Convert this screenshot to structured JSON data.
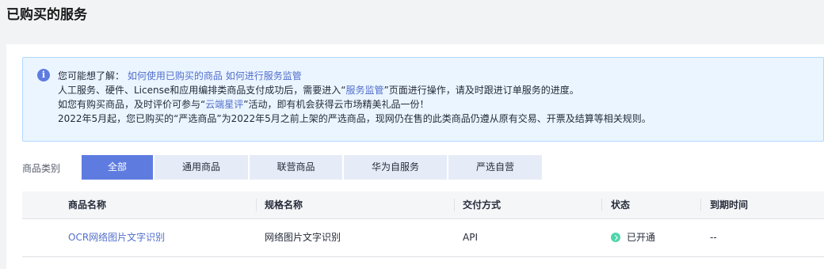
{
  "page": {
    "title": "已购买的服务"
  },
  "notice": {
    "line1": {
      "prefix": "您可能想了解：",
      "link1": "如何使用已购买的商品",
      "link2": "如何进行服务监管"
    },
    "line2": {
      "prefix": "人工服务、硬件、License和应用编排类商品支付成功后，需要进入“",
      "link": "服务监管",
      "suffix": "”页面进行操作，请及时跟进订单服务的进度。"
    },
    "line3": {
      "prefix": "如您有购买商品，及时评价可参与“",
      "link": "云端星评",
      "suffix": "”活动，即有机会获得云市场精美礼品一份！"
    },
    "line4": {
      "text": "2022年5月起，您已购买的“严选商品”为2022年5月之前上架的严选商品，现网仍在售的此类商品仍遵从原有交易、开票及结算等相关规则。"
    }
  },
  "filter": {
    "label": "商品类别",
    "tabs": [
      {
        "label": "全部",
        "active": true
      },
      {
        "label": "通用商品",
        "active": false
      },
      {
        "label": "联营商品",
        "active": false
      },
      {
        "label": "华为自服务",
        "active": false
      },
      {
        "label": "严选自营",
        "active": false
      }
    ]
  },
  "table": {
    "headers": [
      "商品名称",
      "规格名称",
      "交付方式",
      "状态",
      "到期时间"
    ],
    "rows": [
      {
        "name": "OCR网络图片文字识别",
        "spec": "网络图片文字识别",
        "delivery": "API",
        "status": "已开通",
        "expiry": "--"
      }
    ]
  },
  "colors": {
    "accent": "#5e7ce0",
    "link": "#526ecc",
    "status_ok": "#50d4ab",
    "notice_bg": "#eaf5ff"
  }
}
